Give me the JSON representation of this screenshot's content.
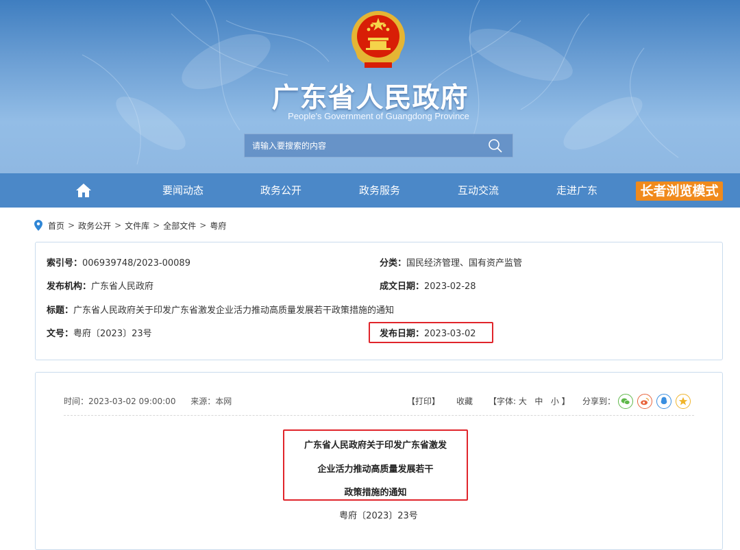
{
  "header": {
    "title": "广东省人民政府",
    "subtitle": "People's Government of Guangdong Province",
    "search_placeholder": "请输入要搜索的内容"
  },
  "nav": {
    "items": [
      "要闻动态",
      "政务公开",
      "政务服务",
      "互动交流",
      "走进广东"
    ],
    "elder_mode": "长者浏览模式"
  },
  "breadcrumb": [
    "首页",
    "政务公开",
    "文件库",
    "全部文件",
    "粤府"
  ],
  "meta": {
    "index_label": "索引号：",
    "index_value": "006939748/2023-00089",
    "category_label": "分类：",
    "category_value": "国民经济管理、国有资产监管",
    "publisher_label": "发布机构：",
    "publisher_value": "广东省人民政府",
    "written_date_label": "成文日期：",
    "written_date_value": "2023-02-28",
    "title_label": "标题：",
    "title_value": "广东省人民政府关于印发广东省激发企业活力推动高质量发展若干政策措施的通知",
    "docno_label": "文号：",
    "docno_value": "粤府〔2023〕23号",
    "publish_date_label": "发布日期：",
    "publish_date_value": "2023-03-02"
  },
  "article": {
    "time": "时间：2023-03-02 09:00:00",
    "source": "来源：本网",
    "print": "【打印】",
    "favorite": "收藏",
    "font_prefix": "【字体:",
    "font_large": "大",
    "font_medium": "中",
    "font_small": "小",
    "font_suffix": "】",
    "share_label": "分享到：",
    "title_lines": [
      "广东省人民政府关于印发广东省激发",
      "企业活力推动高质量发展若干",
      "政策措施的通知"
    ],
    "doc_number": "粤府〔2023〕23号"
  },
  "colors": {
    "nav_bg": "#4b88c8",
    "elder_btn": "#f08a1c",
    "highlight_box": "#e0242a",
    "border": "#c9dbed"
  }
}
